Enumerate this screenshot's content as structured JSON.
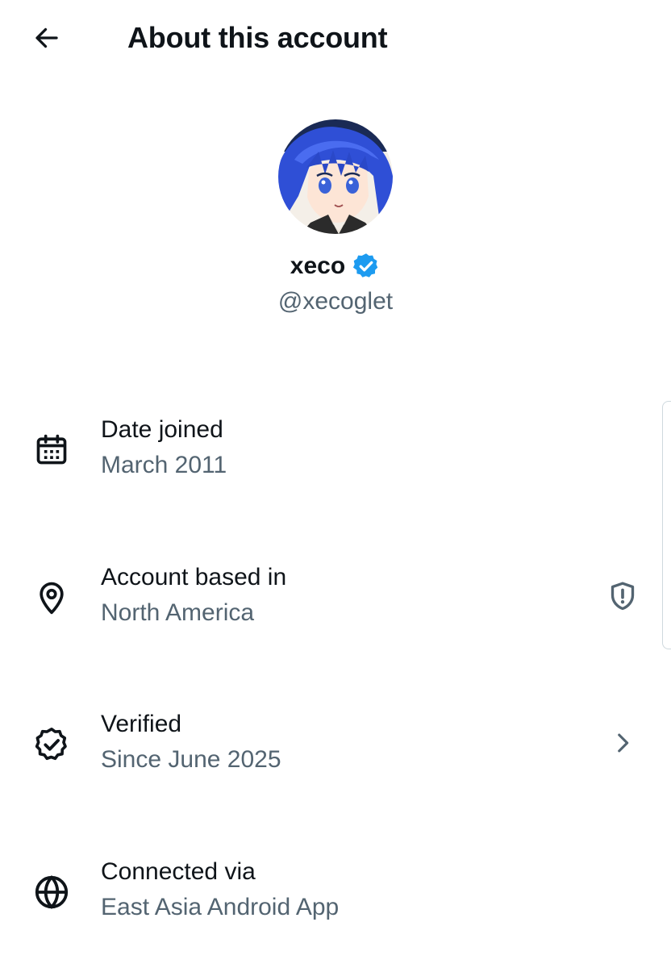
{
  "header": {
    "title": "About this account",
    "back_icon": "arrow-left-icon"
  },
  "profile": {
    "display_name": "xeco",
    "handle": "@xecoglet",
    "verified_badge_color": "#1d9bf0",
    "avatar_icon": "anime-avatar"
  },
  "rows": [
    {
      "icon": "calendar-icon",
      "title": "Date joined",
      "value": "March 2011"
    },
    {
      "icon": "location-pin-icon",
      "title": "Account based in",
      "value": "North America",
      "action_icon": "shield-alert-icon"
    },
    {
      "icon": "verified-badge-icon",
      "title": "Verified",
      "value": "Since June 2025",
      "action_icon": "chevron-right-icon"
    },
    {
      "icon": "globe-icon",
      "title": "Connected via",
      "value": "East Asia Android App"
    }
  ],
  "colors": {
    "primary_text": "#0f1419",
    "secondary_text": "#536471",
    "accent": "#1d9bf0"
  }
}
